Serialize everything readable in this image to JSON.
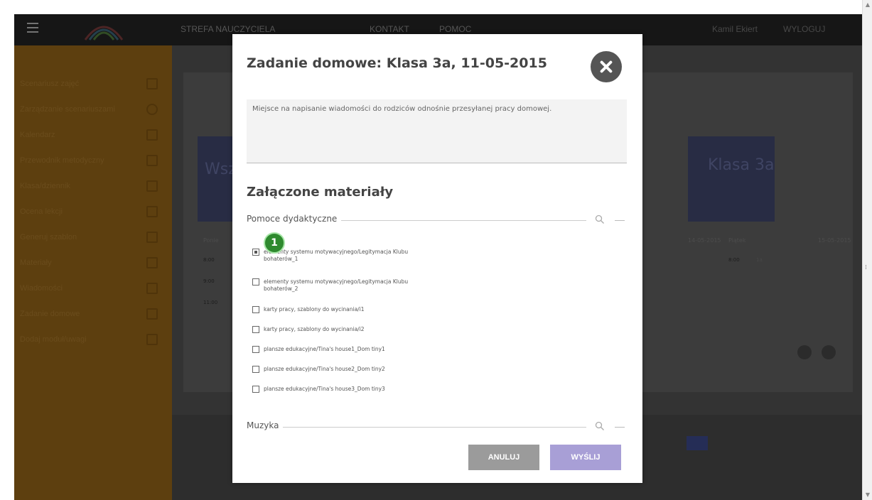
{
  "topbar": {
    "nav": [
      "STREFA NAUCZYCIELA",
      "KONTAKT",
      "POMOC"
    ],
    "user": "Kamil Ekiert",
    "logout": "WYLOGUJ"
  },
  "sidebar": {
    "items": [
      {
        "label": "Scenariusz zajęć",
        "icon": "edit-icon"
      },
      {
        "label": "Zarządzanie scenariuszami",
        "icon": "clock-icon"
      },
      {
        "label": "Kalendarz",
        "icon": "calendar-icon"
      },
      {
        "label": "Przewodnik metodyczny",
        "icon": "book-icon"
      },
      {
        "label": "Klasa/dziennik",
        "icon": "journal-icon"
      },
      {
        "label": "Ocena lekcji",
        "icon": "chart-icon"
      },
      {
        "label": "Generuj szablon",
        "icon": "template-icon"
      },
      {
        "label": "Materiały",
        "icon": "film-icon"
      },
      {
        "label": "Wiadomości",
        "icon": "mail-icon"
      },
      {
        "label": "Zadanie domowe",
        "icon": "homework-icon"
      },
      {
        "label": "Dodaj moduł/uwagi",
        "icon": "note-icon"
      }
    ]
  },
  "background": {
    "tiles": [
      "Wsz kl",
      "Klasa 3a"
    ],
    "schedule": {
      "col1_label": "Ponie",
      "col_date1": "14-05-2015",
      "col_day2": "Piątek",
      "col_date2": "15-05-2015",
      "times": [
        "8:00",
        "9:00",
        "11:00"
      ],
      "class": "1a"
    }
  },
  "modal": {
    "title": "Zadanie domowe: Klasa 3a, 11-05-2015",
    "message_placeholder": "Miejsce na napisanie wiadomości do rodziców odnośnie przesyłanej pracy domowej.",
    "attachments_title": "Załączone materiały",
    "groups": [
      {
        "label": "Pomoce dydaktyczne",
        "items": [
          {
            "label": "elementy systemu motywacyjnego/Legitymacja Klubu bohaterów_1",
            "checked": true
          },
          {
            "label": "elementy systemu motywacyjnego/Legitymacja Klubu bohaterów_2",
            "checked": false
          },
          {
            "label": "karty pracy, szablony do wycinania/i1",
            "checked": false
          },
          {
            "label": "karty pracy, szablony do wycinania/i2",
            "checked": false
          },
          {
            "label": "plansze edukacyjne/Tina's house1_Dom tiny1",
            "checked": false
          },
          {
            "label": "plansze edukacyjne/Tina's house2_Dom tiny2",
            "checked": false
          },
          {
            "label": "plansze edukacyjne/Tina's house3_Dom tiny3",
            "checked": false
          }
        ]
      },
      {
        "label": "Muzyka",
        "items": []
      }
    ],
    "cancel_label": "ANULUJ",
    "send_label": "WYŚLIJ",
    "badge": "1"
  },
  "colors": {
    "sidebar": "#6e4a12",
    "send_button": "#a89fd6",
    "cancel_button": "#9b9b9b",
    "badge": "#2e8a2e"
  }
}
